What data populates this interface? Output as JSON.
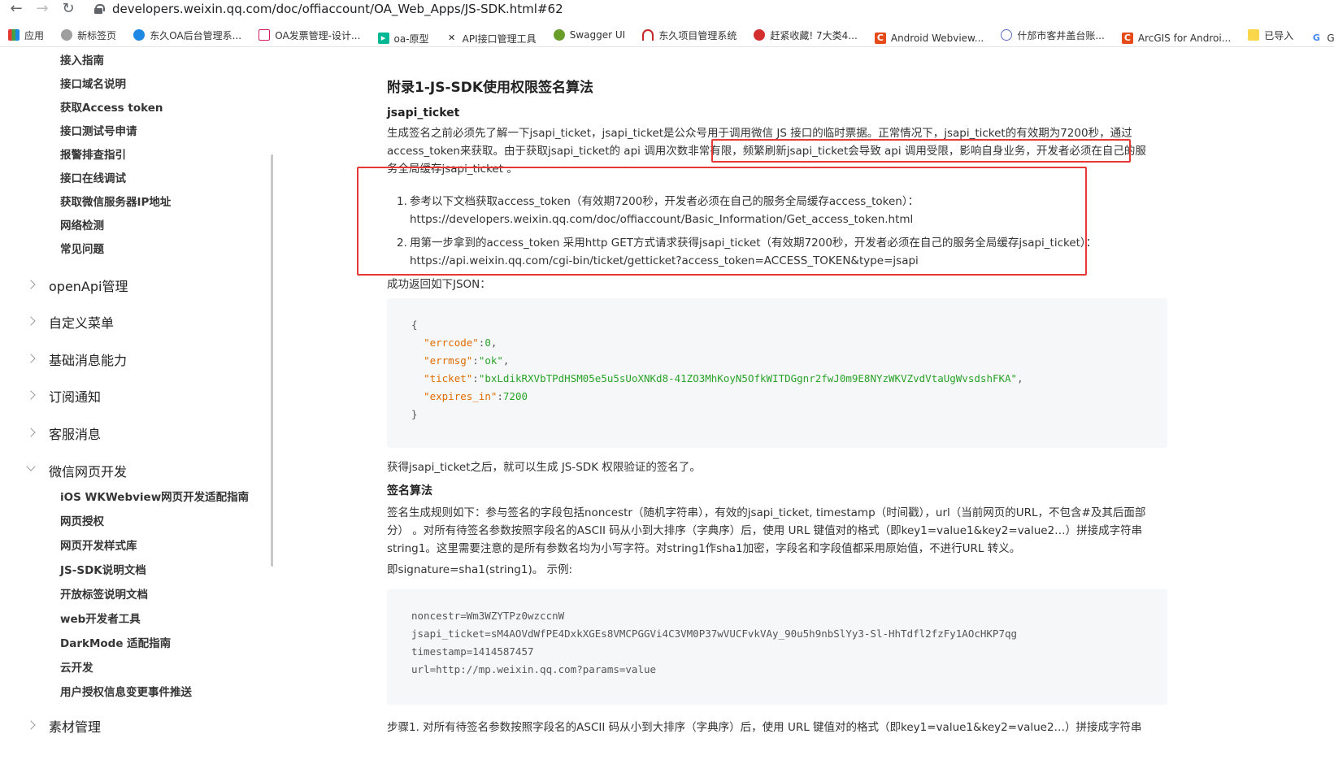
{
  "browser": {
    "url": "developers.weixin.qq.com/doc/offiaccount/OA_Web_Apps/JS-SDK.html#62",
    "bookmarks": [
      "应用",
      "新标签页",
      "东久OA后台管理系...",
      "OA发票管理-设计...",
      "oa-原型",
      "API接口管理工具",
      "Swagger UI",
      "东久项目管理系统",
      "赶紧收藏! 7大类4...",
      "Android Webview...",
      "什邡市客井盖台账...",
      "ArcGIS for Androi...",
      "已导入",
      "Goo"
    ]
  },
  "sidebar": {
    "top_items": [
      "接入指南",
      "接口域名说明",
      "获取Access token",
      "接口测试号申请",
      "报警排查指引",
      "接口在线调试",
      "获取微信服务器IP地址",
      "网络检测",
      "常见问题"
    ],
    "groups": [
      "openApi管理",
      "自定义菜单",
      "基础消息能力",
      "订阅通知",
      "客服消息",
      "微信网页开发"
    ],
    "web_items": [
      "iOS WKWebview网页开发适配指南",
      "网页授权",
      "网页开发样式库",
      "JS-SDK说明文档",
      "开放标签说明文档",
      "web开发者工具",
      "DarkMode 适配指南",
      "云开发",
      "用户授权信息变更事件推送"
    ],
    "last_group": "素材管理"
  },
  "content": {
    "title": "附录1-JS-SDK使用权限签名算法",
    "sub1": "jsapi_ticket",
    "para1_line1": "生成签名之前必须先了解一下jsapi_ticket，jsapi_ticket是公众号用于调用微信 JS 接口的临时票据。正常情况下，jsapi_ticket的有效期为7200秒，通过",
    "para1_line2a": "access_token来获取。由于获取jsapi_ticket的 api 调用次数非常有限，",
    "para1_line2b": "频繁刷新jsapi_ticket会导致 api 调用受限，影响自身业务，开发者必须在自己的服",
    "para1_line3": "务全局缓存jsapi_ticket 。",
    "step1_line1": "参考以下文档获取access_token（有效期7200秒，开发者必须在自己的服务全局缓存access_token）：",
    "step1_line2": "https://developers.weixin.qq.com/doc/offiaccount/Basic_Information/Get_access_token.html",
    "step2_line1": "用第一步拿到的access_token 采用http GET方式请求获得jsapi_ticket（有效期7200秒，开发者必须在自己的服务全局缓存jsapi_ticket）：",
    "step2_line2": "https://api.weixin.qq.com/cgi-bin/ticket/getticket?access_token=ACCESS_TOKEN&type=jsapi",
    "success_text": "成功返回如下JSON：",
    "json": {
      "errcode_key": "\"errcode\"",
      "errcode_val": "0",
      "errmsg_key": "\"errmsg\"",
      "errmsg_val": "\"ok\"",
      "ticket_key": "\"ticket\"",
      "ticket_val": "\"bxLdikRXVbTPdHSM05e5u5sUoXNKd8-41ZO3MhKoyN5OfkWITDGgnr2fwJ0m9E8NYzWKVZvdVtaUgWvsdshFKA\"",
      "expires_key": "\"expires_in\"",
      "expires_val": "7200"
    },
    "after_json": "获得jsapi_ticket之后，就可以生成 JS-SDK 权限验证的签名了。",
    "sub2": "签名算法",
    "rule_line1": "签名生成规则如下：参与签名的字段包括noncestr（随机字符串），有效的jsapi_ticket, timestamp（时间戳），url（当前网页的URL，不包含#及其后面部",
    "rule_line2": "分） 。对所有待签名参数按照字段名的ASCII 码从小到大排序（字典序）后，使用 URL 键值对的格式（即key1=value1&key2=value2…）拼接成字符串",
    "rule_line3": "string1。这里需要注意的是所有参数名均为小写字符。对string1作sha1加密，字段名和字段值都采用原始值，不进行URL 转义。",
    "signature_line": "即signature=sha1(string1)。 示例:",
    "example": {
      "noncestr": "noncestr=Wm3WZYTPz0wzccnW",
      "jsapi_ticket": "jsapi_ticket=sM4AOVdWfPE4DxkXGEs8VMCPGGVi4C3VM0P37wVUCFvkVAy_90u5h9nbSlYy3-Sl-HhTdfl2fzFy1AOcHKP7qg",
      "timestamp": "timestamp=1414587457",
      "url": "url=http://mp.weixin.qq.com?params=value"
    },
    "cut_line": "步骤1. 对所有待签名参数按照字段名的ASCII 码从小到大排序（字典序）后，使用 URL 键值对的格式（即key1=value1&key2=value2…）拼接成字符串"
  }
}
